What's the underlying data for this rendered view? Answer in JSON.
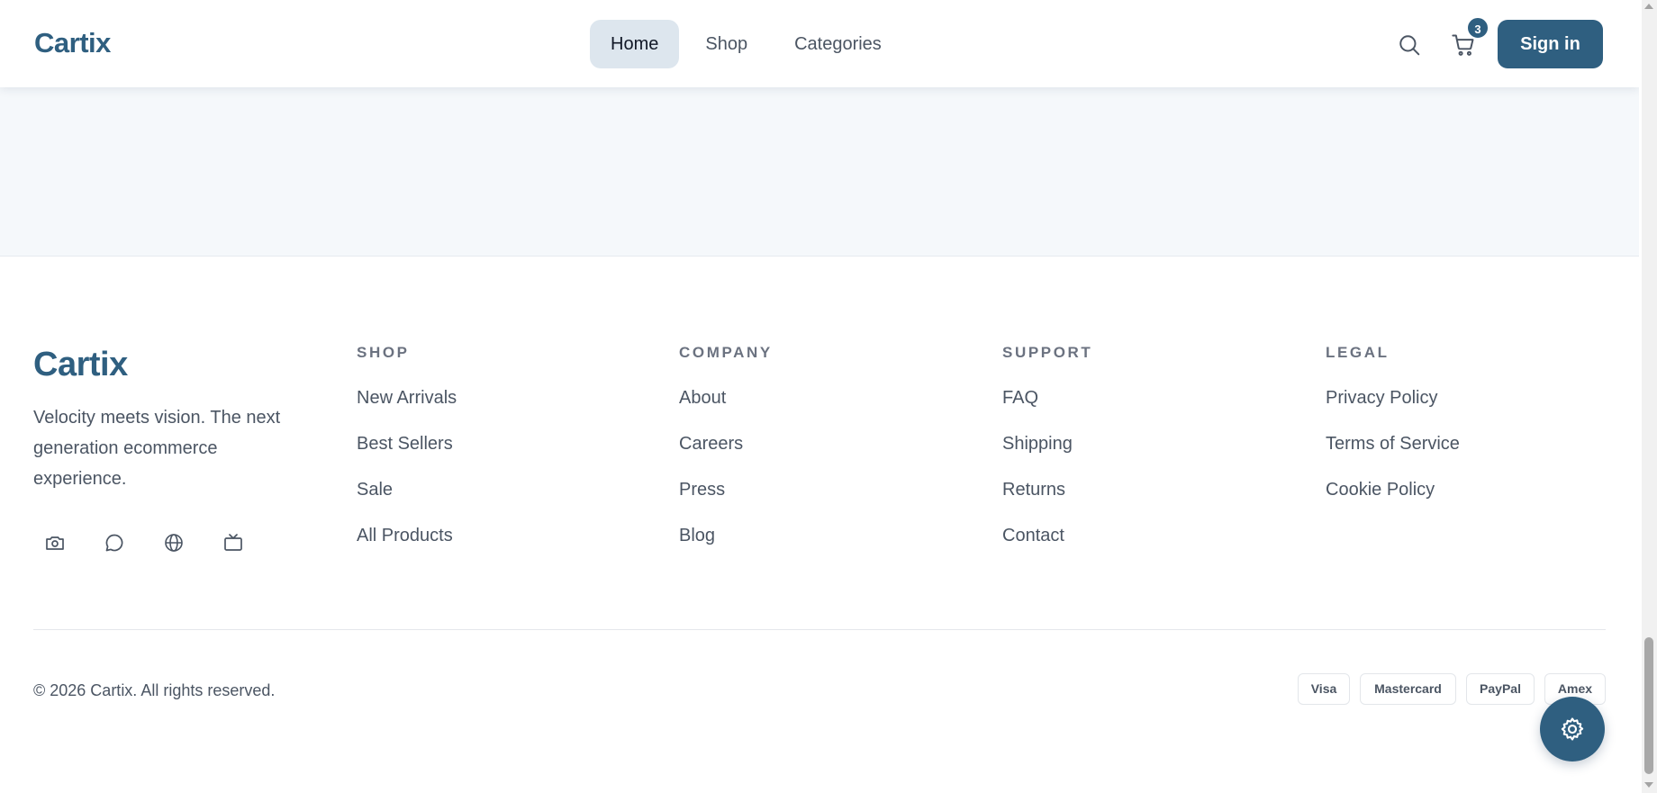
{
  "header": {
    "logo": "Cartix",
    "nav": [
      {
        "label": "Home",
        "active": true
      },
      {
        "label": "Shop",
        "active": false
      },
      {
        "label": "Categories",
        "active": false
      }
    ],
    "cart_count": "3",
    "signin_label": "Sign in",
    "icons": [
      "search-icon",
      "cart-icon"
    ]
  },
  "footer": {
    "brand": "Cartix",
    "tagline": "Velocity meets vision. The next generation ecommerce experience.",
    "social_icons": [
      "camera-icon",
      "chat-icon",
      "globe-icon",
      "tv-icon"
    ],
    "columns": [
      {
        "title": "SHOP",
        "links": [
          "New Arrivals",
          "Best Sellers",
          "Sale",
          "All Products"
        ]
      },
      {
        "title": "COMPANY",
        "links": [
          "About",
          "Careers",
          "Press",
          "Blog"
        ]
      },
      {
        "title": "SUPPORT",
        "links": [
          "FAQ",
          "Shipping",
          "Returns",
          "Contact"
        ]
      },
      {
        "title": "LEGAL",
        "links": [
          "Privacy Policy",
          "Terms of Service",
          "Cookie Policy"
        ]
      }
    ],
    "copyright": "© 2026 Cartix. All rights reserved.",
    "payments": [
      "Visa",
      "Mastercard",
      "PayPal",
      "Amex"
    ]
  },
  "fab_icon": "gear-icon",
  "colors": {
    "brand": "#2f5f80",
    "nav_active_bg": "#dde6ee",
    "upper_bg": "#f5f8fb"
  }
}
